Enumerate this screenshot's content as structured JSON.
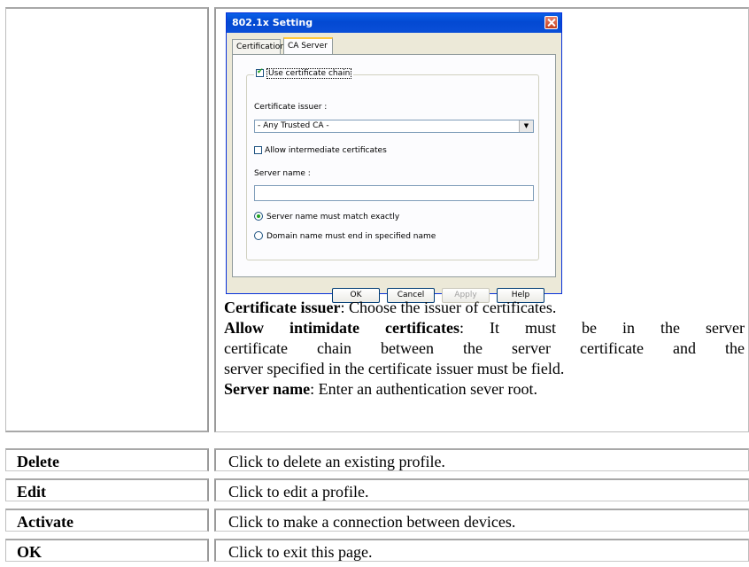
{
  "dialog": {
    "title": "802.1x Setting",
    "tabs": [
      "Certification",
      "CA Server"
    ],
    "active_tab": "CA Server",
    "use_chain_label": "Use certificate chain",
    "use_chain_checked": true,
    "issuer_label": "Certificate issuer :",
    "issuer_value": "- Any Trusted CA -",
    "allow_intermediate_label": "Allow intermediate certificates",
    "allow_intermediate_checked": false,
    "server_name_label": "Server name :",
    "server_name_value": "",
    "radio_exact_label": "Server name must match exactly",
    "radio_exact_selected": true,
    "radio_domain_label": "Domain name must end in specified name",
    "buttons": {
      "ok": "OK",
      "cancel": "Cancel",
      "apply": "Apply",
      "help": "Help"
    }
  },
  "description": {
    "issuer_term": "Certificate issuer",
    "issuer_text": ": Choose the issuer of certificates.",
    "allow_term": "Allow intimidate certificates",
    "allow_text_1": ": It must be in the server",
    "allow_text_2": "certificate chain between the server certificate and the",
    "allow_text_3": "server specified in the certificate issuer must be field.",
    "server_term": "Server name",
    "server_text": ": Enter an authentication sever root."
  },
  "rows": [
    {
      "term": "Delete",
      "desc": "Click to delete an existing profile."
    },
    {
      "term": "Edit",
      "desc": "Click to edit a profile."
    },
    {
      "term": "Activate",
      "desc": "Click to make a connection between devices."
    },
    {
      "term": "OK",
      "desc": "Click to exit this page."
    }
  ]
}
